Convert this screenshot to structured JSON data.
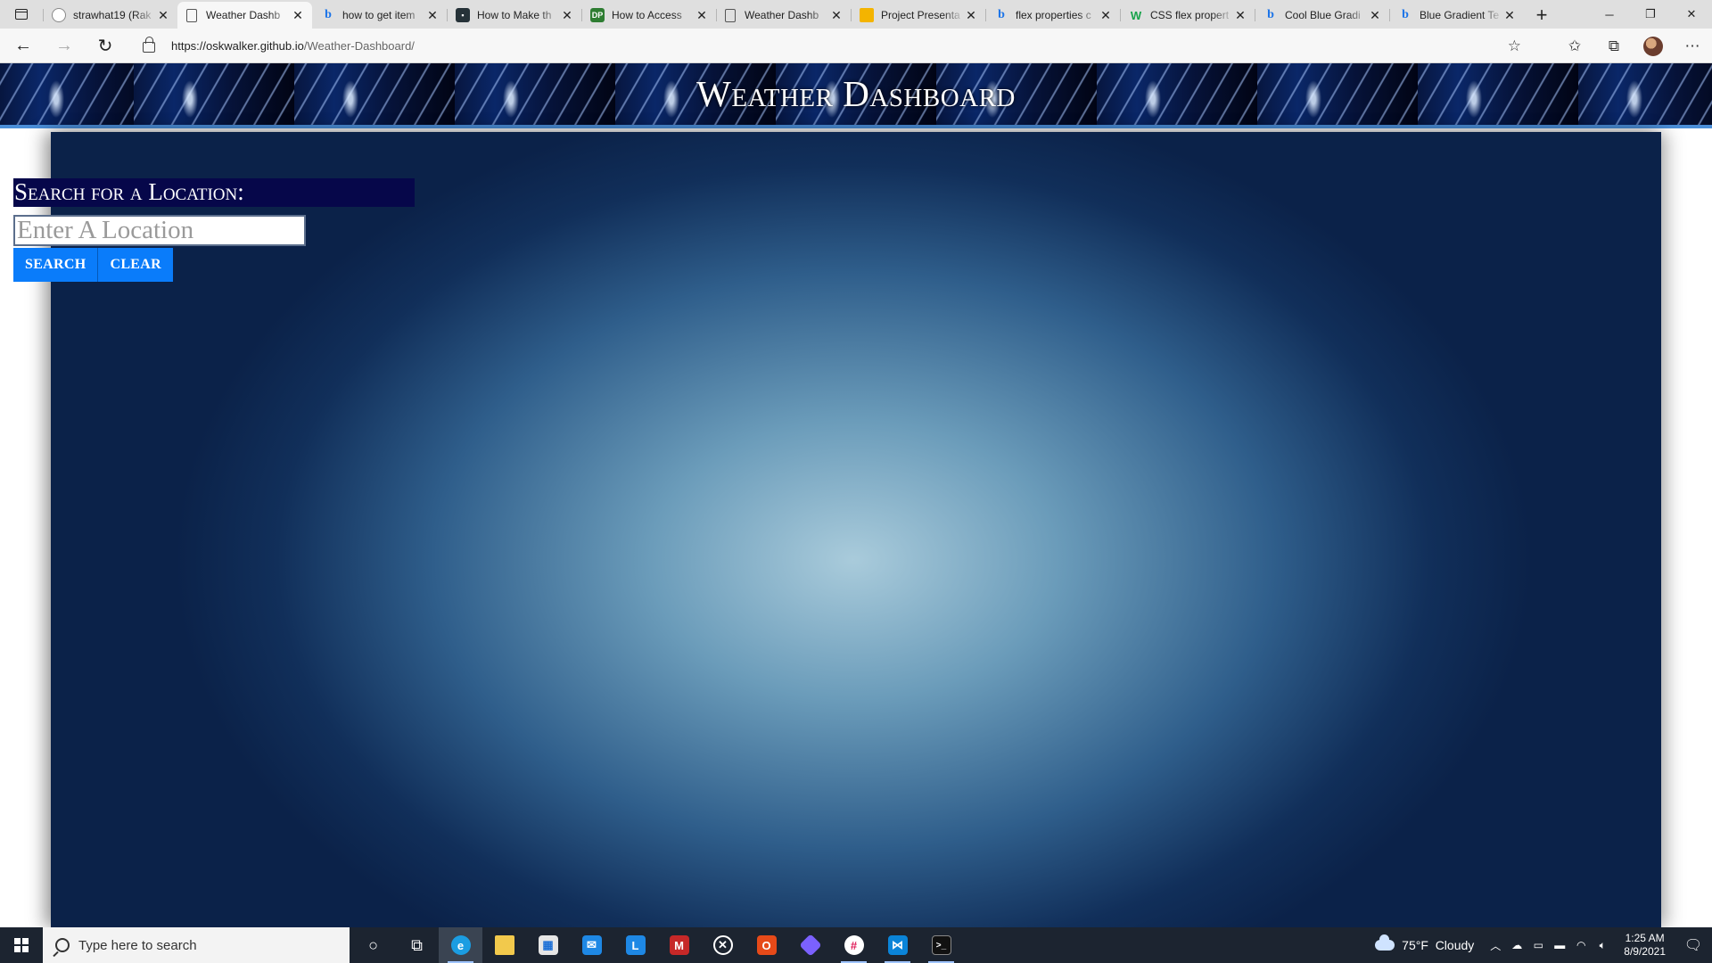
{
  "browser": {
    "tabs": [
      {
        "title": "strawhat19 (Rak",
        "icon": "github-icon",
        "active": false
      },
      {
        "title": "Weather Dashb",
        "icon": "page-icon",
        "active": true
      },
      {
        "title": "how to get item",
        "icon": "bing-icon",
        "active": false
      },
      {
        "title": "How to Make th",
        "icon": "site-icon",
        "active": false
      },
      {
        "title": "How to Access",
        "icon": "dp-icon",
        "active": false
      },
      {
        "title": "Weather Dashb",
        "icon": "page-icon",
        "active": false
      },
      {
        "title": "Project Presenta",
        "icon": "slides-icon",
        "active": false
      },
      {
        "title": "flex properties c",
        "icon": "bing-icon",
        "active": false
      },
      {
        "title": "CSS flex propert",
        "icon": "w3schools-icon",
        "active": false
      },
      {
        "title": "Cool Blue Gradi",
        "icon": "bing-icon",
        "active": false
      },
      {
        "title": "Blue Gradient Te",
        "icon": "bing-icon",
        "active": false
      }
    ],
    "url_host": "https://oskwalker.github.io",
    "url_path": "/Weather-Dashboard/"
  },
  "page": {
    "title": "Weather Dashboard",
    "search_label": "Search for a Location:",
    "search_placeholder": "Enter A Location",
    "search_button": "SEARCH",
    "clear_button": "CLEAR"
  },
  "taskbar": {
    "search_placeholder": "Type here to search",
    "weather_temp": "75°F",
    "weather_desc": "Cloudy",
    "time": "1:25 AM",
    "date": "8/9/2021"
  },
  "colors": {
    "header_underline": "#4b8fd9",
    "label_bg": "#06074a",
    "button_bg": "#0a7cfa"
  }
}
